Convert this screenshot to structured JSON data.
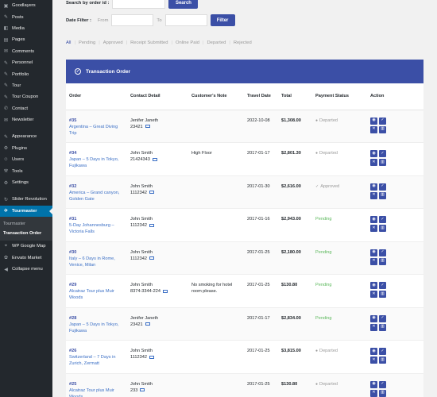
{
  "sidebar": {
    "items": [
      {
        "label": "Goodlayers",
        "icon": "goodlayers-icon"
      },
      {
        "label": "Posts",
        "icon": "pin-icon"
      },
      {
        "label": "Media",
        "icon": "media-icon"
      },
      {
        "label": "Pages",
        "icon": "page-icon"
      },
      {
        "label": "Comments",
        "icon": "comment-icon"
      },
      {
        "label": "Personnel",
        "icon": "pin-icon"
      },
      {
        "label": "Portfolio",
        "icon": "pin-icon"
      },
      {
        "label": "Tour",
        "icon": "pin-icon"
      },
      {
        "label": "Tour Coupon",
        "icon": "pin-icon"
      },
      {
        "label": "Contact",
        "icon": "contact-icon"
      },
      {
        "label": "Newsletter",
        "icon": "newsletter-icon"
      }
    ],
    "items2": [
      {
        "label": "Appearance",
        "icon": "brush-icon"
      },
      {
        "label": "Plugins",
        "icon": "plugin-icon"
      },
      {
        "label": "Users",
        "icon": "user-icon"
      },
      {
        "label": "Tools",
        "icon": "wrench-icon"
      },
      {
        "label": "Settings",
        "icon": "settings-icon"
      }
    ],
    "items3": [
      {
        "label": "Slider Revolution",
        "icon": "refresh-icon"
      }
    ],
    "active": {
      "label": "Tourmaster",
      "icon": "tourmaster-icon"
    },
    "submenu": [
      "Tourmaster",
      "Transaction Order"
    ],
    "items4": [
      {
        "label": "WP Google Map",
        "icon": "map-icon"
      },
      {
        "label": "Envato Market",
        "icon": "envato-icon"
      },
      {
        "label": "Collapse menu",
        "icon": "collapse-icon"
      }
    ]
  },
  "filters": {
    "search_label": "Search by order id :",
    "search_button": "Search",
    "date_label": "Date Filter :",
    "from_label": "From",
    "to_label": "To",
    "filter_button": "Filter"
  },
  "status_tabs": [
    "All",
    "Pending",
    "Approved",
    "Receipt Submitted",
    "Online Paid",
    "Departed",
    "Rejected"
  ],
  "panel": {
    "title": "Transaction Order",
    "columns": [
      "Order",
      "Contact Detail",
      "Customer's Note",
      "Travel Date",
      "Total",
      "Payment Status",
      "Action"
    ]
  },
  "orders": [
    {
      "id": "#35",
      "title": "Argentina – Great Diving Trip",
      "name": "Jenifer Janeth",
      "phone": "23421",
      "note": "",
      "date": "2022-10-08",
      "total": "$1,308.00",
      "status": "Departed",
      "status_type": "departed"
    },
    {
      "id": "#34",
      "title": "Japan – 5 Days in Tokyo, Fujikawa",
      "name": "John Smith",
      "phone": "21424343",
      "note": "High Floor",
      "date": "2017-01-17",
      "total": "$2,801.30",
      "status": "Departed",
      "status_type": "departed"
    },
    {
      "id": "#32",
      "title": "America – Grand canyon, Golden Gate",
      "name": "John Smith",
      "phone": "1112342",
      "note": "",
      "date": "2017-01-30",
      "total": "$2,616.00",
      "status": "Approved",
      "status_type": "approved"
    },
    {
      "id": "#31",
      "title": "5-Day Johannesburg – Victoria Falls",
      "name": "John Smith",
      "phone": "1112342",
      "note": "",
      "date": "2017-01-16",
      "total": "$2,943.00",
      "status": "Pending",
      "status_type": "pending"
    },
    {
      "id": "#30",
      "title": "Italy – 6 Days in Rome, Venice, Milan",
      "name": "John Smith",
      "phone": "1112342",
      "note": "",
      "date": "2017-01-25",
      "total": "$2,180.00",
      "status": "Pending",
      "status_type": "pending"
    },
    {
      "id": "#29",
      "title": "Alcatraz Tour plus Muir Woods",
      "name": "John Smith",
      "phone": "8374-3344-224",
      "note": "No smoking for hotel room please.",
      "date": "2017-01-25",
      "total": "$130.80",
      "status": "Pending",
      "status_type": "pending"
    },
    {
      "id": "#28",
      "title": "Japan – 5 Days in Tokyo, Fujikawa",
      "name": "Jenifer Janeth",
      "phone": "23421",
      "note": "",
      "date": "2017-01-17",
      "total": "$2,834.00",
      "status": "Pending",
      "status_type": "pending"
    },
    {
      "id": "#26",
      "title": "Switzerland – 7 Days in Zurich, Zermatt",
      "name": "John Smith",
      "phone": "1112342",
      "note": "",
      "date": "2017-01-25",
      "total": "$3,815.00",
      "status": "Departed",
      "status_type": "departed"
    },
    {
      "id": "#25",
      "title": "Alcatraz Tour plus Muir Woods",
      "name": "John Smith",
      "phone": "233",
      "note": "",
      "date": "2017-01-25",
      "total": "$130.80",
      "status": "Departed",
      "status_type": "departed"
    }
  ],
  "colors": {
    "accent": "#3b4fa6",
    "pending": "#5cb85c",
    "sidebar": "#23282d",
    "active_menu": "#0073aa"
  }
}
